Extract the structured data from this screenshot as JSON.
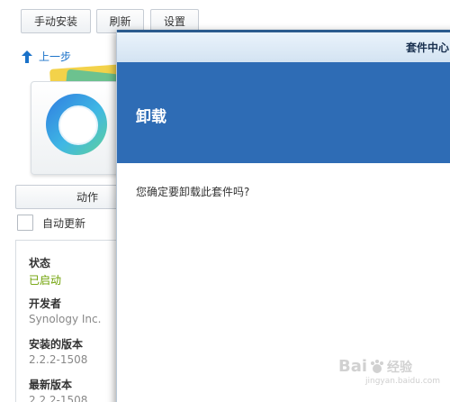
{
  "toolbar": {
    "install_label": "手动安装",
    "refresh_label": "刷新",
    "settings_label": "设置"
  },
  "nav": {
    "back_label": "上一步"
  },
  "package": {
    "action_label": "动作",
    "auto_update_label": "自动更新",
    "info": [
      {
        "label": "状态",
        "value": "已启动"
      },
      {
        "label": "开发者",
        "value": "Synology Inc."
      },
      {
        "label": "安装的版本",
        "value": "2.2.2-1508"
      },
      {
        "label": "最新版本",
        "value": "2.2.2-1508"
      }
    ]
  },
  "dialog": {
    "window_title": "套件中心",
    "heading": "卸载",
    "message": "您确定要卸载此套件吗?"
  },
  "watermark": {
    "text": "Bai",
    "text2": "经验",
    "sub": "jingyan.baidu.com"
  },
  "colors": {
    "accent": "#2e6cb5",
    "running": "#6ca000",
    "link": "#1a72c9"
  }
}
